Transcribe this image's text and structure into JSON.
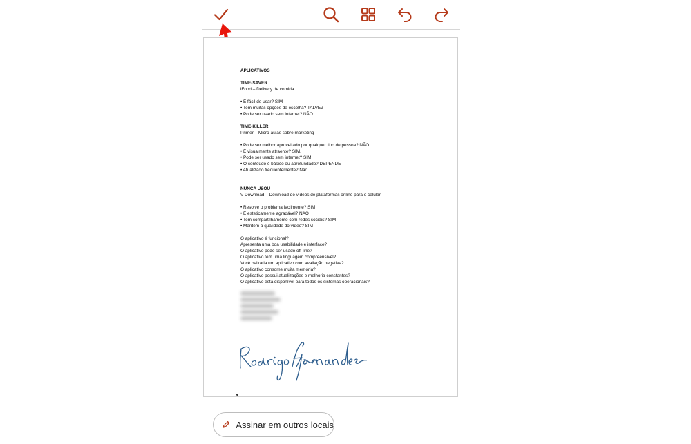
{
  "colors": {
    "accent": "#b53a1a",
    "arrow": "#e8160c",
    "signature_ink": "#2e5e8e"
  },
  "toolbar": {
    "done_icon": "checkmark-icon",
    "search_icon": "search-icon",
    "grid_icon": "grid-icon",
    "undo_icon": "undo-icon",
    "redo_icon": "redo-icon"
  },
  "document": {
    "title": "APLICATIVOS",
    "section1": {
      "heading": "TIME-SAVER",
      "subtitle": "iFood – Delivery de comida",
      "items": [
        "• É fácil de usar? SIM",
        "• Tem muitas opções de escolha? TALVEZ",
        "• Pode ser usado sem internet? NÃO"
      ]
    },
    "section2": {
      "heading": "TIME-KILLER",
      "subtitle": "Primer – Micro-aulas sobre marketing",
      "items": [
        "• Pode ser melhor aproveitado por qualquer tipo de pessoa? NÃO.",
        "• É visualmente atraente? SIM.",
        "• Pode ser usado sem internet? SIM",
        "• O conteúdo é básico ou aprofundado? DEPENDE",
        "• Atualizado frequentemente? Não"
      ]
    },
    "section3": {
      "heading": "NUNCA USOU",
      "subtitle": "V-Download – Download de vídeos de plataformas online para o celular",
      "items": [
        "• Resolve o problema facilmente? SIM.",
        "• É esteticamente agradável? NÃO",
        "• Tem compartilhamento com redes sociais? SIM",
        "• Mantém a qualidade do vídeo? SIM"
      ]
    },
    "questions": [
      "O aplicativo é funcional?",
      "Apresenta uma boa usabilidade e interface?",
      "O aplicativo pode ser usado off-line?",
      "O aplicativo tem uma linguagem compreensível?",
      "Você baixaria um aplicativo com avaliação negativa?",
      "O aplicativo consome muita memória?",
      "O aplicativo possui atualizações e melhoria constantes?",
      "O aplicativo está disponível para todos os sistemas operacionais?"
    ],
    "signature": "Rodrigo Fernandes"
  },
  "sign_button": {
    "label": "Assinar em outros locais",
    "icon": "pencil-icon"
  }
}
